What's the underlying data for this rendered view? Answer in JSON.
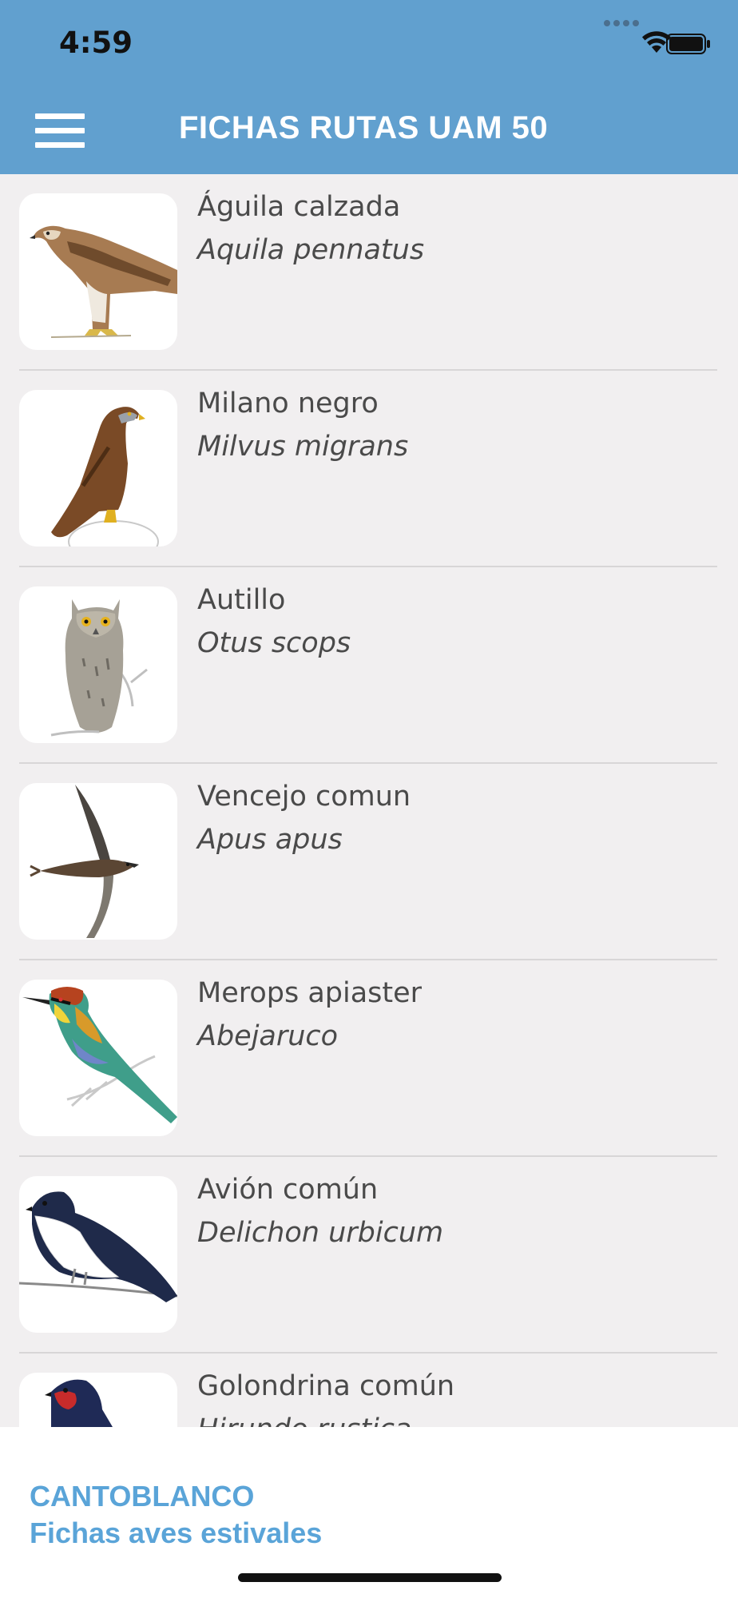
{
  "status_bar": {
    "time": "4:59",
    "icons": [
      "signal-icon",
      "wifi-icon",
      "battery-icon"
    ]
  },
  "nav": {
    "title": "FICHAS RUTAS UAM 50",
    "menu_icon": "hamburger-menu-icon"
  },
  "birds": [
    {
      "common": "Águila calzada",
      "scientific": "Aquila pennatus",
      "image": "booted-eagle-image"
    },
    {
      "common": "Milano negro",
      "scientific": "Milvus migrans",
      "image": "black-kite-image"
    },
    {
      "common": "Autillo",
      "scientific": "Otus scops",
      "image": "scops-owl-image"
    },
    {
      "common": "Vencejo comun",
      "scientific": "Apus apus",
      "image": "common-swift-image"
    },
    {
      "common": "Merops apiaster",
      "scientific": "Abejaruco",
      "image": "bee-eater-image"
    },
    {
      "common": "Avión común",
      "scientific": "Delichon urbicum",
      "image": "house-martin-image"
    },
    {
      "common": "Golondrina común",
      "scientific": "Hirundo rustica",
      "image": "barn-swallow-image"
    }
  ],
  "footer": {
    "title": "CANTOBLANCO",
    "subtitle": "Fichas aves estivales"
  },
  "colors": {
    "header": "#61a0cf",
    "background": "#f1eff0",
    "footer_text": "#5aa4d8",
    "text": "#4a4a4a"
  }
}
